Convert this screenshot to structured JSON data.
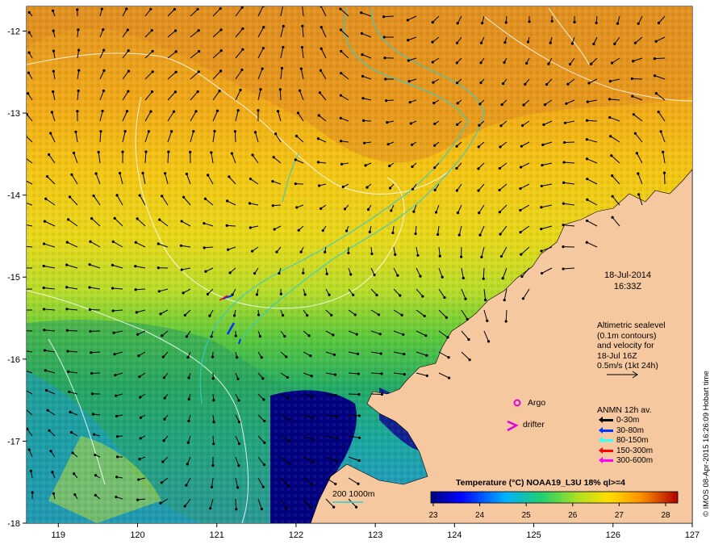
{
  "map": {
    "x_axis_labels": [
      "119",
      "120",
      "121",
      "122",
      "123",
      "124",
      "125",
      "126",
      "127"
    ],
    "y_axis_labels": [
      "-12",
      "-13",
      "-14",
      "-15",
      "-16",
      "-17",
      "-18"
    ],
    "lon_range": [
      118.6,
      127
    ],
    "lat_range": [
      -18,
      -11.7
    ],
    "colors": {
      "land": "#f5c8a0",
      "deep_blue": "#000080",
      "contour_white": "#ffffff",
      "contour_cyan": "#33cccc"
    }
  },
  "labels": {
    "date": "18-Jul-2014",
    "time": "16:33Z",
    "altimetry_lines": [
      "Altimetric sealevel",
      "(0.1m contours)",
      "and velocity for",
      "18-Jul 16Z",
      "0.5m/s (1kt 24h)"
    ],
    "argo": "Argo",
    "drifter": "drifter",
    "drifter_symbol": ">",
    "anmn_title": "ANMN 12h av.",
    "anmn_items": [
      {
        "label": "0-30m",
        "color": "#000000"
      },
      {
        "label": "30-80m",
        "color": "#0033ff"
      },
      {
        "label": "80-150m",
        "color": "#33ffff"
      },
      {
        "label": "150-300m",
        "color": "#ff0000"
      },
      {
        "label": "300-600m",
        "color": "#ff00ff"
      }
    ],
    "contour_legend": "200  1000m",
    "colorbar_title": "Temperature (°C) NOAA19_L3U 18% ql>=4",
    "colorbar_ticks": [
      "23",
      "24",
      "25",
      "26",
      "27",
      "28"
    ],
    "credit": "© IMOS 08-Apr-2015 16:26:09 Hobart time"
  }
}
